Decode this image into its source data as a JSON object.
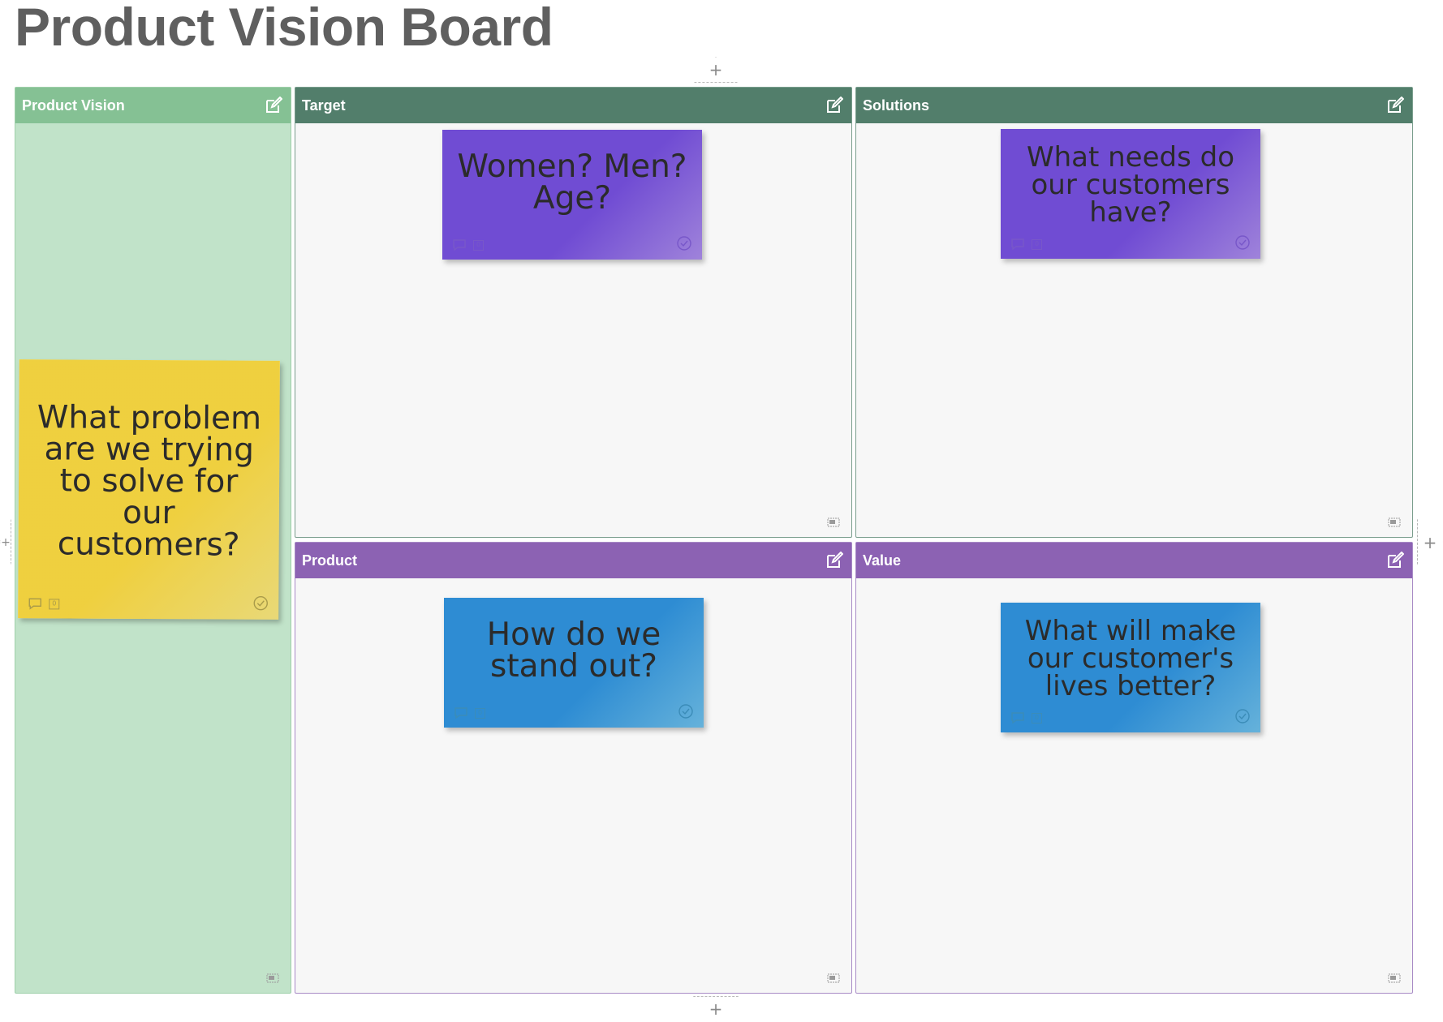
{
  "board": {
    "title": "Product Vision Board",
    "add_symbol": "+"
  },
  "lanes": {
    "vision": {
      "title": "Product Vision",
      "header_color": "#85c194",
      "body_color": "#c1e3c9",
      "border_color": "#9fd0aa",
      "note": {
        "text": "What problem are we trying to solve for our customers?",
        "color": "#f7e67f",
        "icon_color": "#a99b4a",
        "count": "0"
      }
    },
    "target": {
      "title": "Target",
      "header_color": "#527e6b",
      "body_color": "#f7f7f7",
      "border_color": "#7a9e8d",
      "note": {
        "text": "Women? Men?\nAge?",
        "color": "#a98be8",
        "icon_color": "#7857c9",
        "count": "0"
      }
    },
    "solutions": {
      "title": "Solutions",
      "header_color": "#527e6b",
      "body_color": "#f7f7f7",
      "border_color": "#7a9e8d",
      "note": {
        "text": "What needs do\nour customers\nhave?",
        "color": "#a98be8",
        "icon_color": "#7857c9",
        "count": "0"
      }
    },
    "product": {
      "title": "Product",
      "header_color": "#8c62b3",
      "body_color": "#f7f7f7",
      "border_color": "#a88bc6",
      "note": {
        "text": "How do we\nstand out?",
        "color": "#6cbde8",
        "icon_color": "#3b8cb8",
        "count": "0"
      }
    },
    "value": {
      "title": "Value",
      "header_color": "#8c62b3",
      "body_color": "#f7f7f7",
      "border_color": "#a88bc6",
      "note": {
        "text": "What will make\nour customer's\nlives better?",
        "color": "#6cbde8",
        "icon_color": "#3b8cb8",
        "count": "0"
      }
    }
  }
}
